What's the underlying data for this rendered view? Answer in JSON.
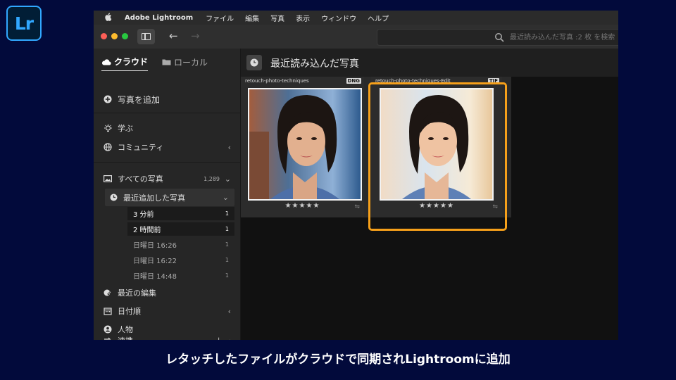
{
  "app_badge": "Lr",
  "menubar": {
    "app_name": "Adobe Lightroom",
    "items": [
      "ファイル",
      "編集",
      "写真",
      "表示",
      "ウィンドウ",
      "ヘルプ"
    ]
  },
  "search": {
    "placeholder": "最近読み込んだ写真 :2 枚 を検索"
  },
  "sidebar": {
    "tabs": [
      {
        "label": "クラウド",
        "active": true
      },
      {
        "label": "ローカル",
        "active": false
      }
    ],
    "add_photos": "写真を追加",
    "learn": "学ぶ",
    "community": "コミュニティ",
    "all_photos": {
      "label": "すべての写真",
      "count": "1,289"
    },
    "recently_added": "最近追加した写真",
    "recent_items": [
      {
        "label": "3 分前",
        "count": "1",
        "selected": true
      },
      {
        "label": "2 時間前",
        "count": "1",
        "selected": true
      },
      {
        "label": "日曜日 16:26",
        "count": "1",
        "selected": false
      },
      {
        "label": "日曜日 16:22",
        "count": "1",
        "selected": false
      },
      {
        "label": "日曜日 14:48",
        "count": "1",
        "selected": false
      }
    ],
    "recent_edits": "最近の編集",
    "by_date": "日付順",
    "people": "人物",
    "connections": "連携"
  },
  "main": {
    "title": "最近読み込んだ写真",
    "photos": [
      {
        "filename": "retouch-photo-techniques",
        "format": "DNG",
        "rating": "★★★★★"
      },
      {
        "filename": "retouch-photo-techniques-Edit",
        "format": "TIF",
        "rating": "★★★★★"
      }
    ]
  },
  "caption": "レタッチしたファイルがクラウドで同期されLightroomに追加",
  "colors": {
    "highlight": "#f6a01a",
    "lr_blue": "#31a8ff",
    "background": "#020a3b"
  }
}
